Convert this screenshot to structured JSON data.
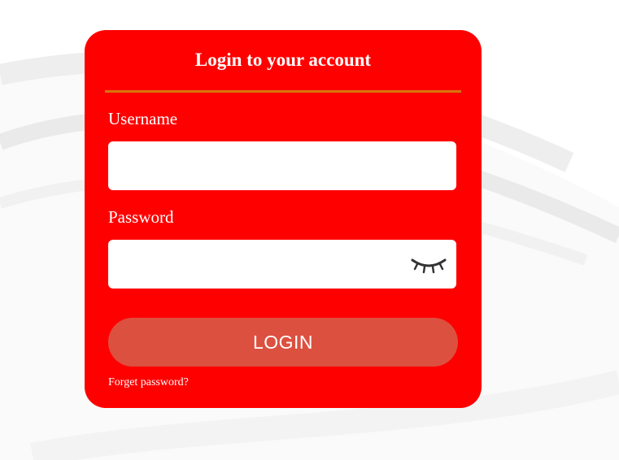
{
  "login": {
    "title": "Login to your account",
    "username_label": "Username",
    "username_value": "",
    "password_label": "Password",
    "password_value": "",
    "login_button": "LOGIN",
    "forgot_link": "Forget password?"
  },
  "icons": {
    "password_toggle": "eye-closed-icon"
  },
  "colors": {
    "card_background": "#ff0000",
    "divider": "#d9750f",
    "login_button": "#dc5040",
    "text": "#ffffff"
  }
}
